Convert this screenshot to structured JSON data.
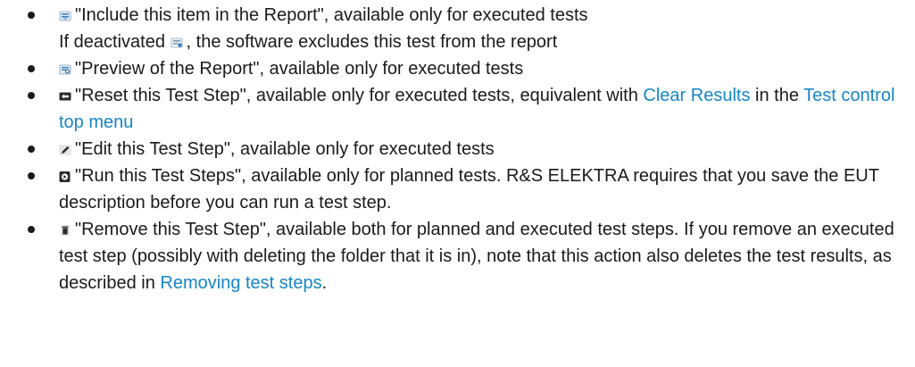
{
  "items": [
    {
      "text": "\"Include this item in the Report\", available only for executed tests",
      "line2_pre": "If deactivated ",
      "line2_post": ", the software excludes this test from the report"
    },
    {
      "text": "\"Preview of the Report\", available only for executed tests"
    },
    {
      "text": "\"Reset this Test Step\", available only for executed tests, equivalent with ",
      "link1": "Clear Results",
      "mid": " in the ",
      "link2": "Test control top menu"
    },
    {
      "text": "\"Edit this Test Step\", available only for executed tests"
    },
    {
      "text": "\"Run this Test Steps\", available only for planned tests. R&S ELEKTRA requires that you save the EUT description before you can run a test step."
    },
    {
      "text": "\"Remove this Test Step\", available both for planned and executed test steps. If you remove an executed test step (possibly with deleting the folder that it is in), note that this action also deletes the test results, as described in ",
      "link": "Removing test steps",
      "end": "."
    }
  ],
  "colors": {
    "text": "#1a1a1a",
    "link": "#1586c7",
    "icon_blue": "#3a7fc0",
    "icon_dark": "#2b2b2b"
  },
  "icons": [
    "report-include-icon",
    "report-excluded-icon",
    "report-preview-icon",
    "reset-icon",
    "edit-icon",
    "run-icon",
    "remove-icon"
  ]
}
